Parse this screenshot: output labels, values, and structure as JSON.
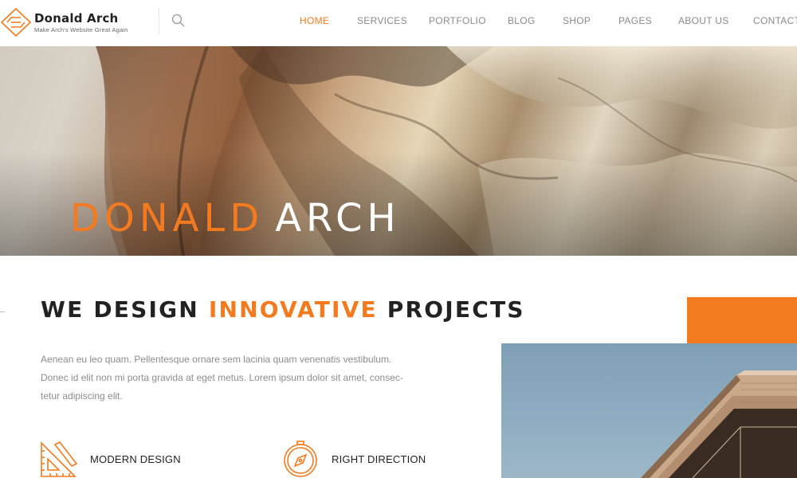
{
  "brand": {
    "title": "Donald Arch",
    "tagline": "Make Arch's Website Great Again",
    "accent_color": "#f47a20",
    "logo_icon": "diamond-logo-icon"
  },
  "header": {
    "search_icon": "search-icon"
  },
  "nav": {
    "items": [
      {
        "label": "HOME",
        "active": true
      },
      {
        "label": "SERVICES",
        "active": false
      },
      {
        "label": "PORTFOLIO",
        "active": false
      },
      {
        "label": "BLOG",
        "active": false
      },
      {
        "label": "SHOP",
        "active": false
      },
      {
        "label": "PAGES",
        "active": false
      },
      {
        "label": "ABOUT US",
        "active": false
      },
      {
        "label": "CONTACT",
        "active": false
      }
    ]
  },
  "hero": {
    "title_accent": "DONALD",
    "title_rest": "ARCH"
  },
  "intro": {
    "heading_start": "WE DESIGN",
    "heading_accent": "INNOVATIVE",
    "heading_end": "PROJECTS",
    "body_lines": [
      "Aenean eu leo quam. Pellentesque ornare sem lacinia quam venenatis vestibulum.",
      "Donec id elit non mi porta gravida at eget metus. Lorem ipsum dolor sit amet, consec-",
      "tetur adipiscing elit."
    ]
  },
  "features": [
    {
      "label": "MODERN DESIGN",
      "icon": "ruler-pencil-icon"
    },
    {
      "label": "RIGHT DIRECTION",
      "icon": "compass-icon"
    }
  ]
}
